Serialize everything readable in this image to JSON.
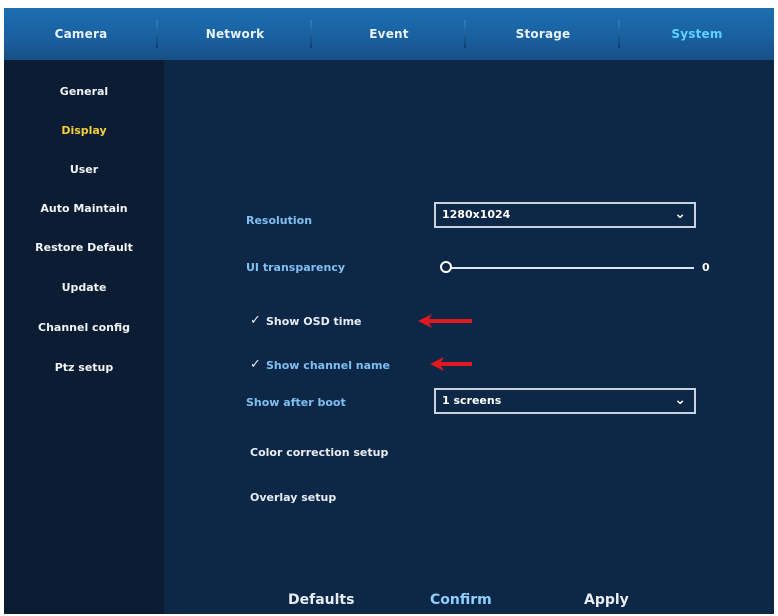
{
  "tabs": [
    {
      "label": "Camera",
      "active": false
    },
    {
      "label": "Network",
      "active": false
    },
    {
      "label": "Event",
      "active": false
    },
    {
      "label": "Storage",
      "active": false
    },
    {
      "label": "System",
      "active": true
    }
  ],
  "sidebar": {
    "items": [
      {
        "label": "General",
        "active": false
      },
      {
        "label": "Display",
        "active": true
      },
      {
        "label": "User",
        "active": false
      },
      {
        "label": "Auto Maintain",
        "active": false
      },
      {
        "label": "Restore Default",
        "active": false
      },
      {
        "label": "Update",
        "active": false
      },
      {
        "label": "Channel config",
        "active": false
      },
      {
        "label": "Ptz setup",
        "active": false
      }
    ]
  },
  "display": {
    "resolution_label": "Resolution",
    "resolution_value": "1280x1024",
    "transparency_label": "UI transparency",
    "transparency_value": "0",
    "show_osd_time_label": "Show OSD time",
    "show_osd_time_checked": true,
    "show_channel_name_label": "Show channel name",
    "show_channel_name_checked": true,
    "show_after_boot_label": "Show after boot",
    "show_after_boot_value": "1 screens",
    "color_correction_label": "Color correction setup",
    "overlay_label": "Overlay setup"
  },
  "buttons": {
    "defaults": "Defaults",
    "confirm": "Confirm",
    "apply": "Apply"
  },
  "icons": {
    "checkmark": "✓",
    "chevron": "⌄",
    "annotation_arrow": "red-left-arrow"
  },
  "colors": {
    "topbar": "#1b6fb0",
    "active_tab": "#5fd0ff",
    "active_menu": "#f6cf3c",
    "annotation_arrow": "#e01820"
  }
}
